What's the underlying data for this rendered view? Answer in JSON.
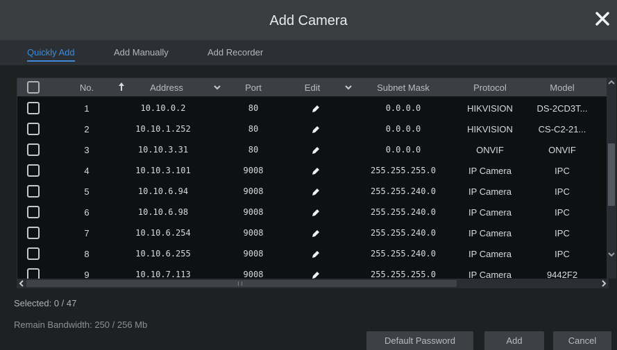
{
  "dialog": {
    "title": "Add Camera"
  },
  "tabs": [
    {
      "label": "Quickly Add",
      "active": true
    },
    {
      "label": "Add Manually",
      "active": false
    },
    {
      "label": "Add Recorder",
      "active": false
    }
  ],
  "table": {
    "headers": {
      "no": "No.",
      "address": "Address",
      "port": "Port",
      "edit": "Edit",
      "subnet": "Subnet Mask",
      "protocol": "Protocol",
      "model": "Model"
    },
    "rows": [
      {
        "no": "1",
        "address": "10.10.0.2",
        "port": "80",
        "subnet": "0.0.0.0",
        "protocol": "HIKVISION",
        "model": "DS-2CD3T..."
      },
      {
        "no": "2",
        "address": "10.10.1.252",
        "port": "80",
        "subnet": "0.0.0.0",
        "protocol": "HIKVISION",
        "model": "CS-C2-21..."
      },
      {
        "no": "3",
        "address": "10.10.3.31",
        "port": "80",
        "subnet": "0.0.0.0",
        "protocol": "ONVIF",
        "model": "ONVIF"
      },
      {
        "no": "4",
        "address": "10.10.3.101",
        "port": "9008",
        "subnet": "255.255.255.0",
        "protocol": "IP Camera",
        "model": "IPC"
      },
      {
        "no": "5",
        "address": "10.10.6.94",
        "port": "9008",
        "subnet": "255.255.240.0",
        "protocol": "IP Camera",
        "model": "IPC"
      },
      {
        "no": "6",
        "address": "10.10.6.98",
        "port": "9008",
        "subnet": "255.255.240.0",
        "protocol": "IP Camera",
        "model": "IPC"
      },
      {
        "no": "7",
        "address": "10.10.6.254",
        "port": "9008",
        "subnet": "255.255.240.0",
        "protocol": "IP Camera",
        "model": "IPC"
      },
      {
        "no": "8",
        "address": "10.10.6.255",
        "port": "9008",
        "subnet": "255.255.240.0",
        "protocol": "IP Camera",
        "model": "IPC"
      },
      {
        "no": "9",
        "address": "10.10.7.113",
        "port": "9008",
        "subnet": "255.255.255.0",
        "protocol": "IP Camera",
        "model": "9442F2"
      }
    ]
  },
  "status": {
    "selected": "Selected: 0 / 47",
    "bandwidth": "Remain Bandwidth: 250 / 256 Mb"
  },
  "buttons": {
    "default_password": "Default Password",
    "add": "Add",
    "cancel": "Cancel"
  },
  "colors": {
    "accent": "#3c8ad8",
    "header_bg": "#3b3f44",
    "row_bg": "#0f1012"
  },
  "icons": [
    "close-icon",
    "sort-up-icon",
    "chevron-down-icon",
    "edit-pencil-icon",
    "scroll-arrow-icon"
  ]
}
